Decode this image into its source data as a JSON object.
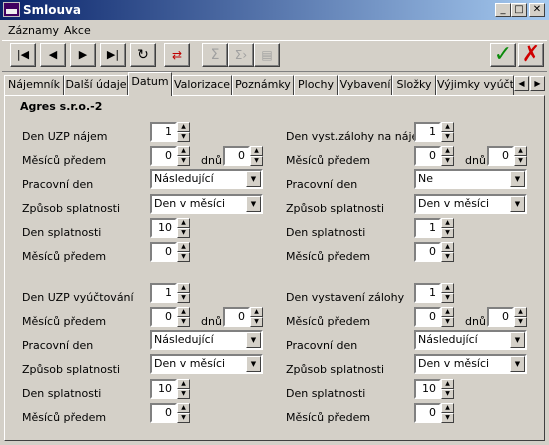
{
  "window": {
    "title": "Smlouva"
  },
  "menu": [
    "Záznamy",
    "Akce"
  ],
  "tabs": [
    "Nájemník",
    "Další údaje",
    "Datum",
    "Valorizace",
    "Poznámky",
    "Plochy",
    "Vybavení",
    "Složky",
    "Výjimky vyúčto"
  ],
  "active_tab": "Datum",
  "company": "Agres s.r.o.-2",
  "labels": {
    "den_uzp_najem": "Den UZP nájem",
    "mesicu_predem": "Měsíců předem",
    "dnu": "dnů",
    "pracovni_den": "Pracovní den",
    "zpusob_splatnosti": "Způsob splatnosti",
    "den_splatnosti": "Den splatnosti",
    "den_vyst_zalohy_najem": "Den vyst.zálohy na nájem",
    "den_uzp_vyuctovani": "Den UZP vyúčtování",
    "den_vystaveni_zalohy": "Den vystavení zálohy"
  },
  "values": {
    "tl_den_uzp": "1",
    "tl_mesicu": "0",
    "tl_dnu": "0",
    "tl_pracovni": "Následující",
    "tl_zpusob": "Den v měsíci",
    "tl_den_spl": "10",
    "tl_mesicu2": "0",
    "tr_den_vyst": "1",
    "tr_mesicu": "0",
    "tr_dnu": "0",
    "tr_pracovni": "Ne",
    "tr_zpusob": "Den v měsíci",
    "tr_den_spl": "1",
    "tr_mesicu2": "0",
    "bl_den_uzp": "1",
    "bl_mesicu": "0",
    "bl_dnu": "0",
    "bl_pracovni": "Následující",
    "bl_zpusob": "Den v měsíci",
    "bl_den_spl": "10",
    "bl_mesicu2": "0",
    "br_den_vyst": "1",
    "br_mesicu": "0",
    "br_dnu": "0",
    "br_pracovni": "Následující",
    "br_zpusob": "Den v měsíci",
    "br_den_spl": "10",
    "br_mesicu2": "0"
  }
}
